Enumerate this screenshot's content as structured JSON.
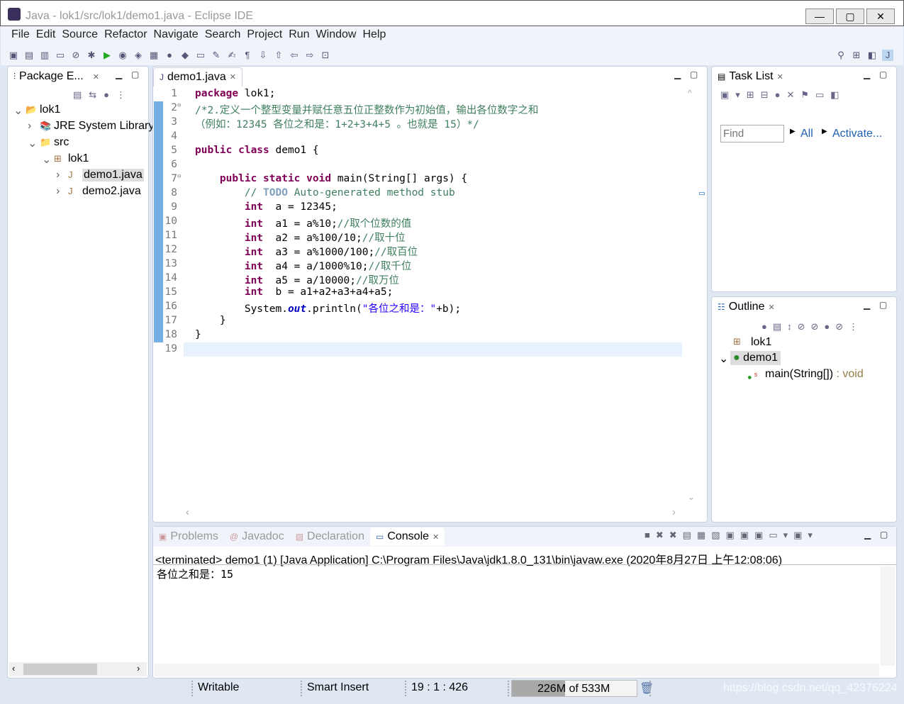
{
  "window": {
    "title": "Java - lok1/src/lok1/demo1.java - Eclipse IDE",
    "min": "—",
    "max": "▢",
    "close": "✕"
  },
  "menu": [
    "File",
    "Edit",
    "Source",
    "Refactor",
    "Navigate",
    "Search",
    "Project",
    "Run",
    "Window",
    "Help"
  ],
  "package_explorer": {
    "tab": "Package E...",
    "items": [
      {
        "label": "lok1",
        "indent": 0,
        "arrow": "⌄",
        "icon": "📂"
      },
      {
        "label": "JRE System Library",
        "indent": 1,
        "arrow": "›",
        "icon": "📚"
      },
      {
        "label": "src",
        "indent": 1,
        "arrow": "⌄",
        "icon": "📁"
      },
      {
        "label": "lok1",
        "indent": 2,
        "arrow": "⌄",
        "icon": "⊞"
      },
      {
        "label": "demo1.java",
        "indent": 3,
        "arrow": "›",
        "icon": "J",
        "selected": true
      },
      {
        "label": "demo2.java",
        "indent": 3,
        "arrow": "›",
        "icon": "J"
      }
    ]
  },
  "editor": {
    "tab": "demo1.java",
    "lines": [
      [
        [
          "kw",
          "package"
        ],
        [
          "",
          "lok1;"
        ]
      ],
      [
        [
          "cm",
          "/*2.定义一个整型变量并赋任意五位正整数作为初始值，输出各位数字之和"
        ]
      ],
      [
        [
          "cm",
          "（例如：12345 各位之和是：1+2+3+4+5 。也就是 15）*/"
        ]
      ],
      [],
      [
        [
          "kw",
          "public class"
        ],
        [
          "",
          "demo1 {"
        ]
      ],
      [],
      [
        [
          "",
          "    "
        ],
        [
          "kw",
          "public static void"
        ],
        [
          "",
          "main(String[] args) {"
        ]
      ],
      [
        [
          "",
          "        "
        ],
        [
          "cm",
          "// "
        ],
        [
          "todo",
          "TODO"
        ],
        [
          "cm",
          " Auto-generated method stub"
        ]
      ],
      [
        [
          "",
          "        "
        ],
        [
          "kw",
          "int"
        ],
        [
          "",
          " a = 12345;"
        ]
      ],
      [
        [
          "",
          "        "
        ],
        [
          "kw",
          "int"
        ],
        [
          "",
          " a1 = a%10;"
        ],
        [
          "cm",
          "//取个位数的值"
        ]
      ],
      [
        [
          "",
          "        "
        ],
        [
          "kw",
          "int"
        ],
        [
          "",
          " a2 = a%100/10;"
        ],
        [
          "cm",
          "//取十位"
        ]
      ],
      [
        [
          "",
          "        "
        ],
        [
          "kw",
          "int"
        ],
        [
          "",
          " a3 = a%1000/100;"
        ],
        [
          "cm",
          "//取百位"
        ]
      ],
      [
        [
          "",
          "        "
        ],
        [
          "kw",
          "int"
        ],
        [
          "",
          " a4 = a/1000%10;"
        ],
        [
          "cm",
          "//取千位"
        ]
      ],
      [
        [
          "",
          "        "
        ],
        [
          "kw",
          "int"
        ],
        [
          "",
          " a5 = a/10000;"
        ],
        [
          "cm",
          "//取万位"
        ]
      ],
      [
        [
          "",
          "        "
        ],
        [
          "kw",
          "int"
        ],
        [
          "",
          " b = a1+a2+a3+a4+a5;"
        ]
      ],
      [
        [
          "",
          "        System."
        ],
        [
          "fld",
          "out"
        ],
        [
          "",
          ".println("
        ],
        [
          "str",
          "\"各位之和是：\""
        ],
        [
          "",
          "+b);"
        ]
      ],
      [
        [
          "",
          "    }"
        ]
      ],
      [
        [
          "",
          "}"
        ]
      ],
      []
    ]
  },
  "task_list": {
    "tab": "Task List",
    "find_placeholder": "Find",
    "all": "All",
    "activate": "Activate..."
  },
  "outline": {
    "tab": "Outline",
    "items": [
      {
        "label": "lok1"
      },
      {
        "label": "demo1"
      },
      {
        "label": "main(String[])",
        "type": " : void"
      }
    ]
  },
  "console": {
    "tabs": [
      "Problems",
      "Javadoc",
      "Declaration",
      "Console"
    ],
    "header": "<terminated> demo1 (1) [Java Application] C:\\Program Files\\Java\\jdk1.8.0_131\\bin\\javaw.exe (2020年8月27日 上午12:08:06)",
    "output": "各位之和是：15"
  },
  "status": {
    "writable": "Writable",
    "insert": "Smart Insert",
    "position": "19 : 1 : 426",
    "heap": "226M of 533M",
    "heap_fraction": 0.424,
    "watermark": "https://blog.csdn.net/qq_42376224"
  }
}
